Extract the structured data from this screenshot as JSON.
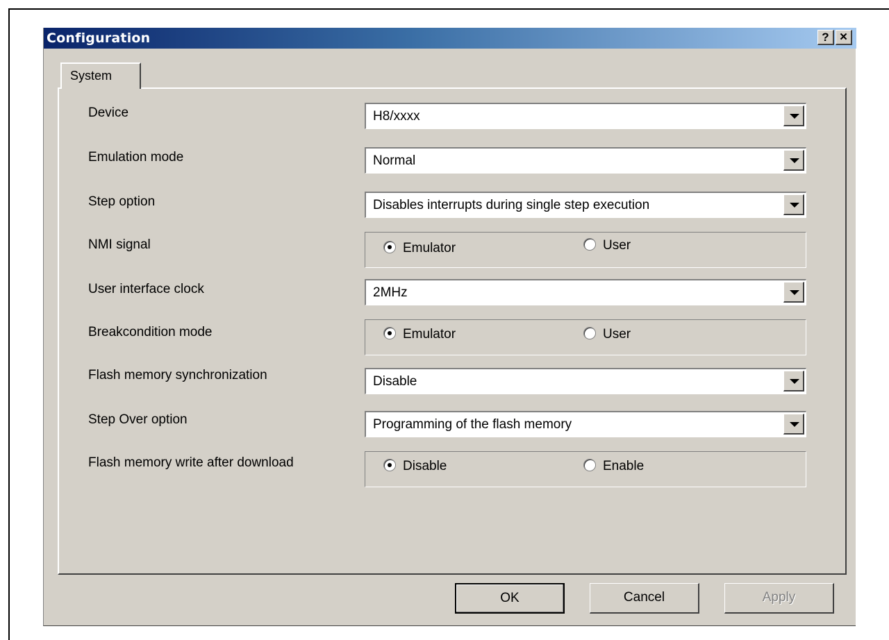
{
  "window": {
    "title": "Configuration"
  },
  "titlebar_buttons": {
    "help": "?",
    "close": "✕"
  },
  "tabs": [
    {
      "label": "System"
    }
  ],
  "fields": {
    "device": {
      "label": "Device",
      "value": "H8/xxxx"
    },
    "emulation_mode": {
      "label": "Emulation mode",
      "value": "Normal"
    },
    "step_option": {
      "label": "Step option",
      "value": "Disables interrupts during single step execution"
    },
    "nmi_signal": {
      "label": "NMI signal",
      "options": [
        "Emulator",
        "User"
      ],
      "selected": "Emulator"
    },
    "user_interface_clock": {
      "label": "User interface clock",
      "value": "2MHz"
    },
    "breakcondition_mode": {
      "label": "Breakcondition mode",
      "options": [
        "Emulator",
        "User"
      ],
      "selected": "Emulator"
    },
    "flash_memory_sync": {
      "label": "Flash memory synchronization",
      "value": "Disable"
    },
    "step_over_option": {
      "label": "Step Over option",
      "value": "Programming of the flash memory"
    },
    "flash_write_after_download": {
      "label": "Flash memory write after download",
      "options": [
        "Disable",
        "Enable"
      ],
      "selected": "Disable"
    }
  },
  "buttons": {
    "ok": "OK",
    "cancel": "Cancel",
    "apply": "Apply"
  }
}
